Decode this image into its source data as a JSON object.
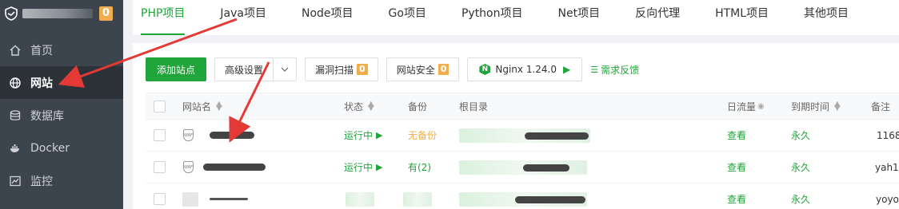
{
  "sidebar": {
    "server_count": "0",
    "items": [
      {
        "label": "首页",
        "icon": "home-icon"
      },
      {
        "label": "网站",
        "icon": "globe-icon",
        "active": true
      },
      {
        "label": "数据库",
        "icon": "database-icon"
      },
      {
        "label": "Docker",
        "icon": "docker-icon"
      },
      {
        "label": "监控",
        "icon": "monitor-icon"
      }
    ]
  },
  "tabs": [
    "PHP项目",
    "Java项目",
    "Node项目",
    "Go项目",
    "Python项目",
    "Net项目",
    "反向代理",
    "HTML项目",
    "其他项目"
  ],
  "toolbar": {
    "add_site": "添加站点",
    "advanced": "高级设置",
    "vuln_scan": "漏洞扫描",
    "vuln_count": "0",
    "site_security": "网站安全",
    "security_count": "0",
    "nginx": "Nginx 1.24.0",
    "feedback": "需求反馈"
  },
  "table": {
    "headers": {
      "name": "网站名",
      "status": "状态",
      "backup": "备份",
      "root": "根目录",
      "traffic": "日流量",
      "expire": "到期时间",
      "remark": "备注"
    },
    "rows": [
      {
        "status": "运行中",
        "backup": "无备份",
        "backup_type": "none",
        "action": "查看",
        "expire": "永久",
        "remark": "1168"
      },
      {
        "status": "运行中",
        "backup": "有(2)",
        "backup_type": "has",
        "action": "查看",
        "expire": "永久",
        "remark": "yah1"
      },
      {
        "status": "",
        "backup": "",
        "backup_type": "hidden",
        "action": "查看",
        "expire": "永久",
        "remark": "yoyo"
      }
    ]
  },
  "colors": {
    "accent": "#20a53a",
    "warning": "#f0ad4e",
    "sidebar_bg": "#3c444d",
    "annotation": "#e53935"
  }
}
